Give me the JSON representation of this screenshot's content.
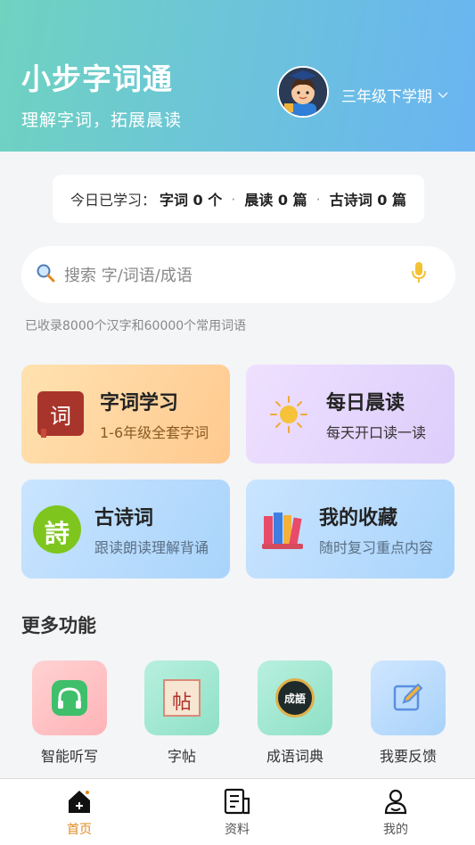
{
  "header": {
    "title": "小步字词通",
    "subtitle": "理解字词，拓展晨读",
    "grade": "三年级下学期",
    "avatar_icon": "student-avatar-icon"
  },
  "today": {
    "label": "今日已学习：",
    "words": "字词 0 个",
    "reading": "晨读 0 篇",
    "poems": "古诗词 0 篇"
  },
  "search": {
    "placeholder": "搜索 字/词语/成语",
    "note": "已收录8000个汉字和60000个常用词语"
  },
  "cards": [
    {
      "title": "字词学习",
      "subtitle": "1-6年级全套字词",
      "icon": "ci-book-icon",
      "glyph": "词"
    },
    {
      "title": "每日晨读",
      "subtitle": "每天开口读一读",
      "icon": "sun-icon"
    },
    {
      "title": "古诗词",
      "subtitle": "跟读朗读理解背诵",
      "icon": "poem-icon",
      "glyph": "詩"
    },
    {
      "title": "我的收藏",
      "subtitle": "随时复习重点内容",
      "icon": "books-icon"
    }
  ],
  "more": {
    "title": "更多功能",
    "items": [
      {
        "label": "智能听写",
        "icon": "headphones-icon"
      },
      {
        "label": "字帖",
        "icon": "copybook-icon",
        "glyph": "帖"
      },
      {
        "label": "成语词典",
        "icon": "idiom-dictionary-icon",
        "glyph": "成語"
      },
      {
        "label": "我要反馈",
        "icon": "feedback-edit-icon"
      }
    ]
  },
  "tabs": [
    {
      "label": "首页",
      "icon": "home-icon",
      "active": true
    },
    {
      "label": "资料",
      "icon": "document-icon",
      "active": false
    },
    {
      "label": "我的",
      "icon": "user-icon",
      "active": false
    }
  ],
  "colors": {
    "accent": "#e08a1e",
    "header_start": "#6fd3c0",
    "header_end": "#6ab4f2"
  }
}
